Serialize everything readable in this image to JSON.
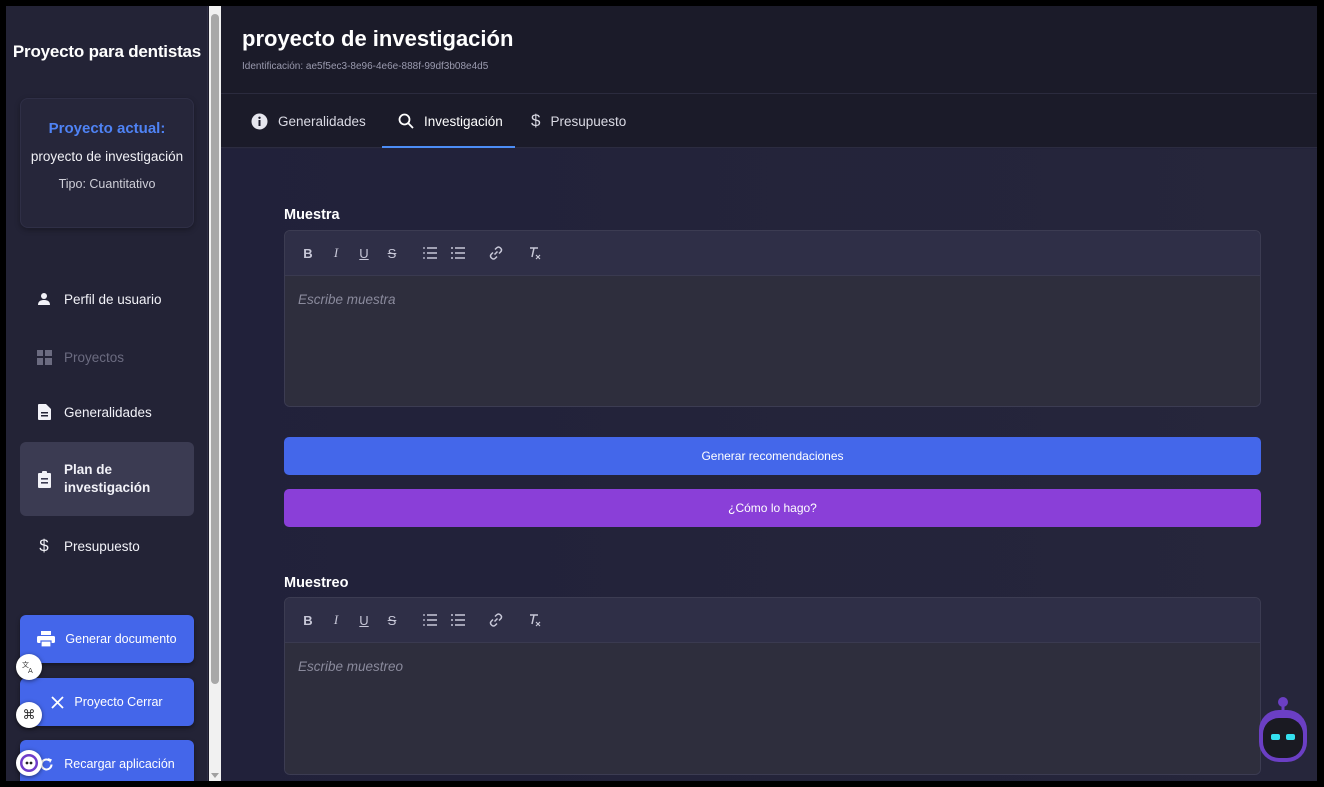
{
  "sidebar": {
    "app_title": "Proyecto para dentistas",
    "project_card": {
      "label": "Proyecto actual:",
      "name": "proyecto de investigación",
      "type": "Tipo: Cuantitativo"
    },
    "nav": [
      {
        "label": "Perfil de usuario",
        "icon": "user-icon"
      },
      {
        "label": "Proyectos",
        "icon": "grid-icon",
        "disabled": true
      },
      {
        "label": "Generalidades",
        "icon": "document-icon"
      },
      {
        "label": "Plan de investigación",
        "line1": "Plan de",
        "line2": "investigación",
        "icon": "clipboard-icon",
        "active": true
      },
      {
        "label": "Presupuesto",
        "icon": "dollar-icon"
      }
    ],
    "buttons": {
      "generate_document": "Generar documento",
      "close_project": "Proyecto Cerrar",
      "reload_app": "Recargar aplicación"
    }
  },
  "header": {
    "title": "proyecto de investigación",
    "identification": "Identificación: ae5f5ec3-8e96-4e6e-888f-99df3b08e4d5"
  },
  "tabs": [
    {
      "label": "Generalidades",
      "icon": "info-icon"
    },
    {
      "label": "Investigación",
      "icon": "search-icon",
      "active": true
    },
    {
      "label": "Presupuesto",
      "icon": "dollar-icon"
    }
  ],
  "sections": {
    "muestra": {
      "label": "Muestra",
      "placeholder": "Escribe muestra"
    },
    "muestreo": {
      "label": "Muestreo",
      "placeholder": "Escribe muestreo"
    }
  },
  "actions": {
    "generate_recommendations": "Generar recomendaciones",
    "how_to": "¿Cómo lo hago?"
  },
  "toolbar_buttons": {
    "bold": "B",
    "italic": "I",
    "underline": "U",
    "strike": "S"
  },
  "colors": {
    "accent_blue": "#4467ea",
    "accent_purple": "#8a3fd8",
    "label_blue": "#4f83f5",
    "tab_underline": "#4c8df6"
  }
}
